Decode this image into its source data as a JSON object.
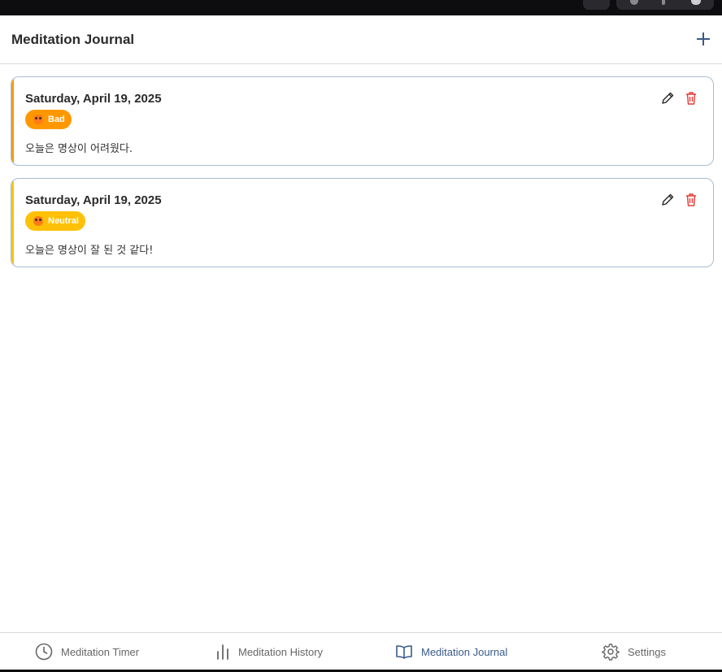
{
  "header": {
    "title": "Meditation Journal",
    "add_icon": "plus-icon"
  },
  "entries": [
    {
      "date": "Saturday, April 19, 2025",
      "mood": "Bad",
      "mood_color": "#ff9800",
      "text": "오늘은 명상이 어려웠다."
    },
    {
      "date": "Saturday, April 19, 2025",
      "mood": "Neutral",
      "mood_color": "#ffc107",
      "text": "오늘은 명상이 잘 된 것 같다!"
    }
  ],
  "colors": {
    "accent": "#3a5a8a",
    "delete": "#e53935",
    "card_border": "#a9bdd0"
  },
  "bottom_nav": [
    {
      "label": "Meditation Timer",
      "icon": "clock-icon"
    },
    {
      "label": "Meditation History",
      "icon": "bar-chart-icon"
    },
    {
      "label": "Meditation Journal",
      "icon": "book-icon",
      "active": true
    },
    {
      "label": "Settings",
      "icon": "gear-icon"
    }
  ]
}
